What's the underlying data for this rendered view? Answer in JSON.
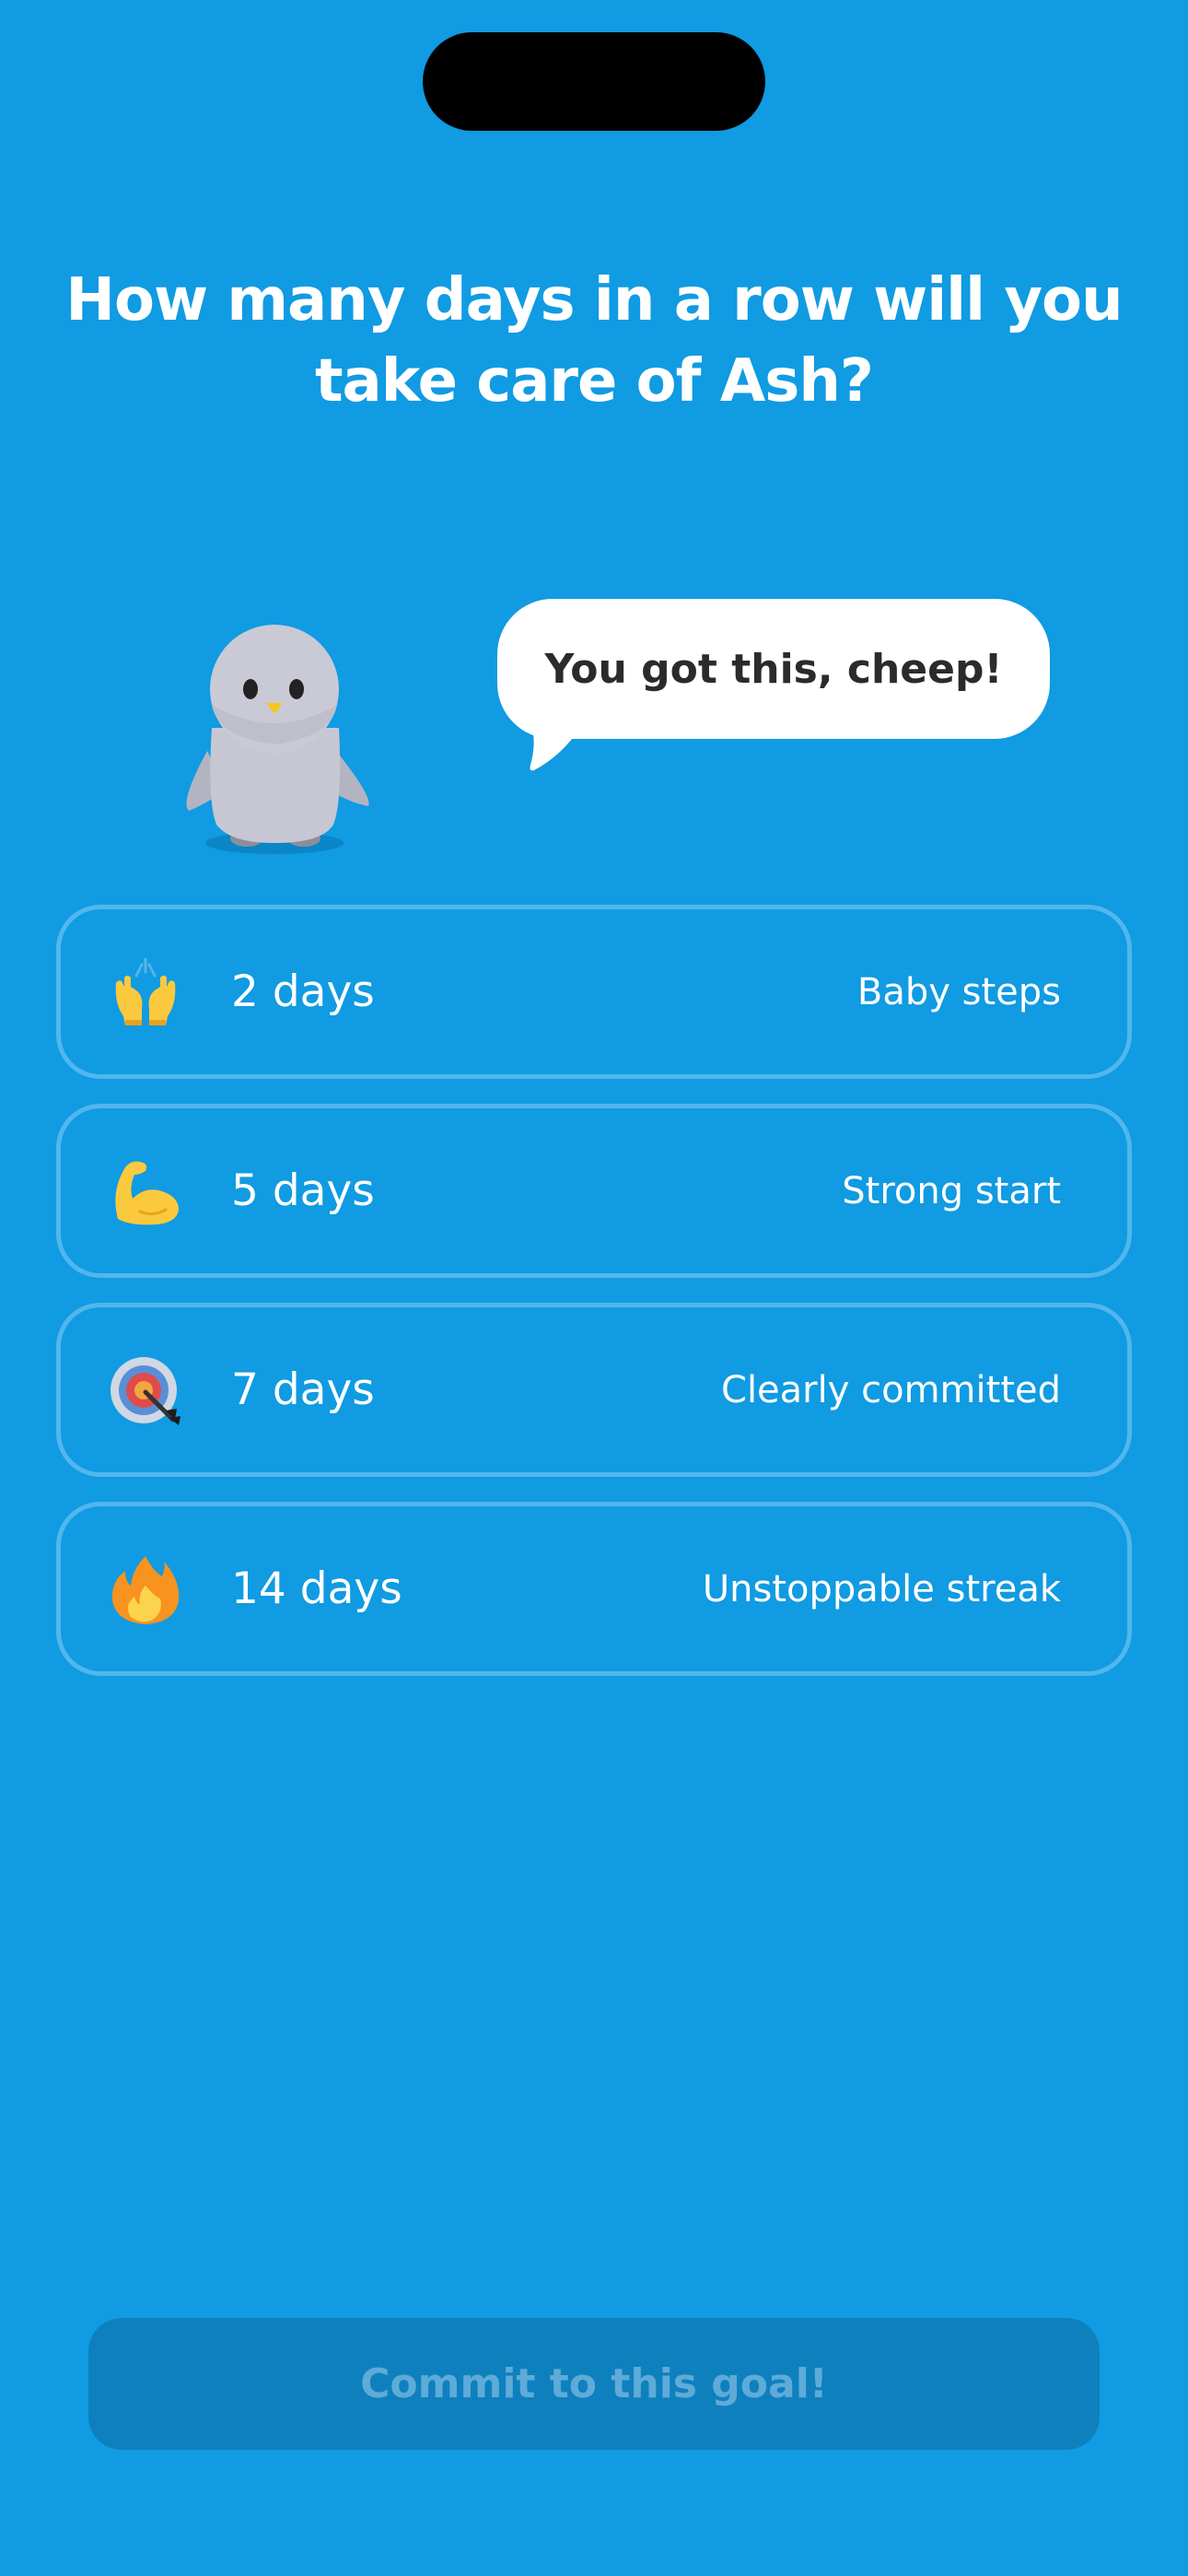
{
  "title": "How many days in a row will you take care of Ash?",
  "speech_bubble": "You got this, cheep!",
  "options": [
    {
      "icon": "raised-hands-icon",
      "days": "2 days",
      "tag": "Baby steps"
    },
    {
      "icon": "flexed-biceps-icon",
      "days": "5 days",
      "tag": "Strong start"
    },
    {
      "icon": "target-icon",
      "days": "7 days",
      "tag": "Clearly committed"
    },
    {
      "icon": "fire-icon",
      "days": "14 days",
      "tag": "Unstoppable streak"
    }
  ],
  "commit_button": "Commit to this goal!",
  "colors": {
    "background": "#109be2",
    "option_border": "#52b6ee",
    "button_disabled_bg": "#0f80be",
    "button_disabled_text": "#5eabd8"
  }
}
